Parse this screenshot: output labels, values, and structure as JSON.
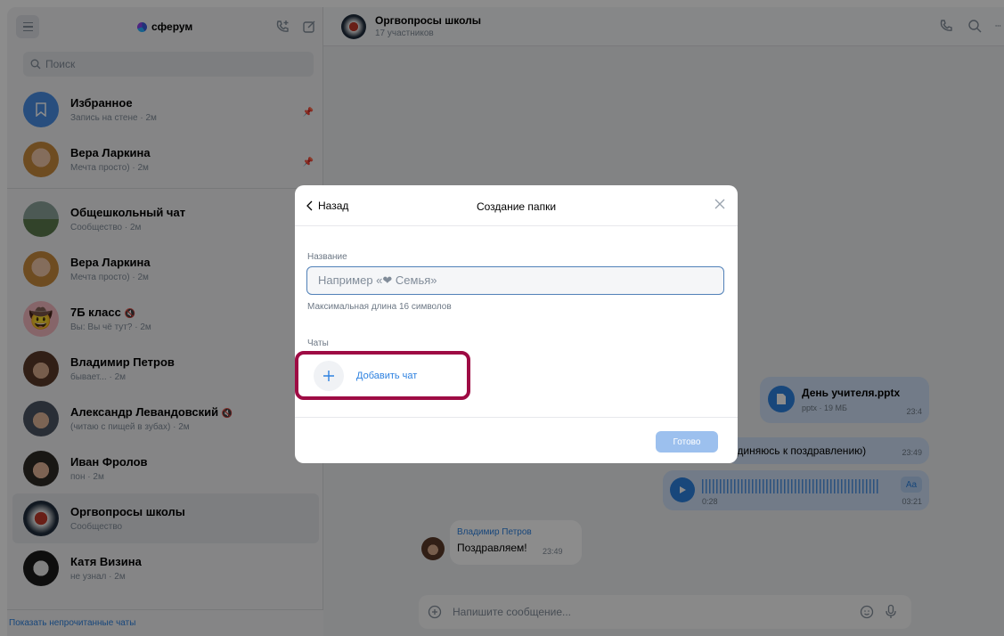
{
  "sidebar": {
    "brand": "сферум",
    "search_placeholder": "Поиск",
    "show_unread": "Показать непрочитанные чаты",
    "pinned": [
      {
        "name": "Избранное",
        "sub": "Запись на стене · 2м",
        "icon": "bookmark-icon"
      },
      {
        "name": "Вера Ларкина",
        "sub": "Мечта просто) · 2м"
      }
    ],
    "chats": [
      {
        "name": "Общешкольный чат",
        "sub": "Сообщество · 2м"
      },
      {
        "name": "Вера Ларкина",
        "sub": "Мечта просто) · 2м"
      },
      {
        "name": "7Б класс",
        "sub": "Вы: Вы чё тут? · 2м",
        "muted": true
      },
      {
        "name": "Владимир Петров",
        "sub": "бывает... · 2м"
      },
      {
        "name": "Александр Левандовский",
        "sub": "(читаю с пищей в зубах) · 2м",
        "muted": true
      },
      {
        "name": "Иван Фролов",
        "sub": "пон · 2м"
      },
      {
        "name": "Оргвопросы школы",
        "sub": "Сообщество",
        "active": true
      },
      {
        "name": "Катя Визина",
        "sub": "не узнал · 2м"
      }
    ]
  },
  "chat": {
    "title": "Оргвопросы школы",
    "subtitle": "17 участников",
    "file_name": "День учителя.pptx",
    "file_meta": "pptx · 19 МБ",
    "file_time": "23:4",
    "msg2_text": "единяюсь к поздравлению)",
    "msg2_time": "23:49",
    "voice_elapsed": "0:28",
    "voice_total": "03:21",
    "voice_btn": "Aa",
    "msg3_author": "Владимир Петров",
    "msg3_text": "Поздравляем!",
    "msg3_time": "23:49",
    "composer_placeholder": "Напишите сообщение..."
  },
  "modal": {
    "back": "Назад",
    "title": "Создание папки",
    "name_label": "Название",
    "name_placeholder": "Например «❤ Семья»",
    "hint": "Максимальная длина 16 символов",
    "chats_label": "Чаты",
    "add_chat": "Добавить чат",
    "done": "Готово"
  }
}
